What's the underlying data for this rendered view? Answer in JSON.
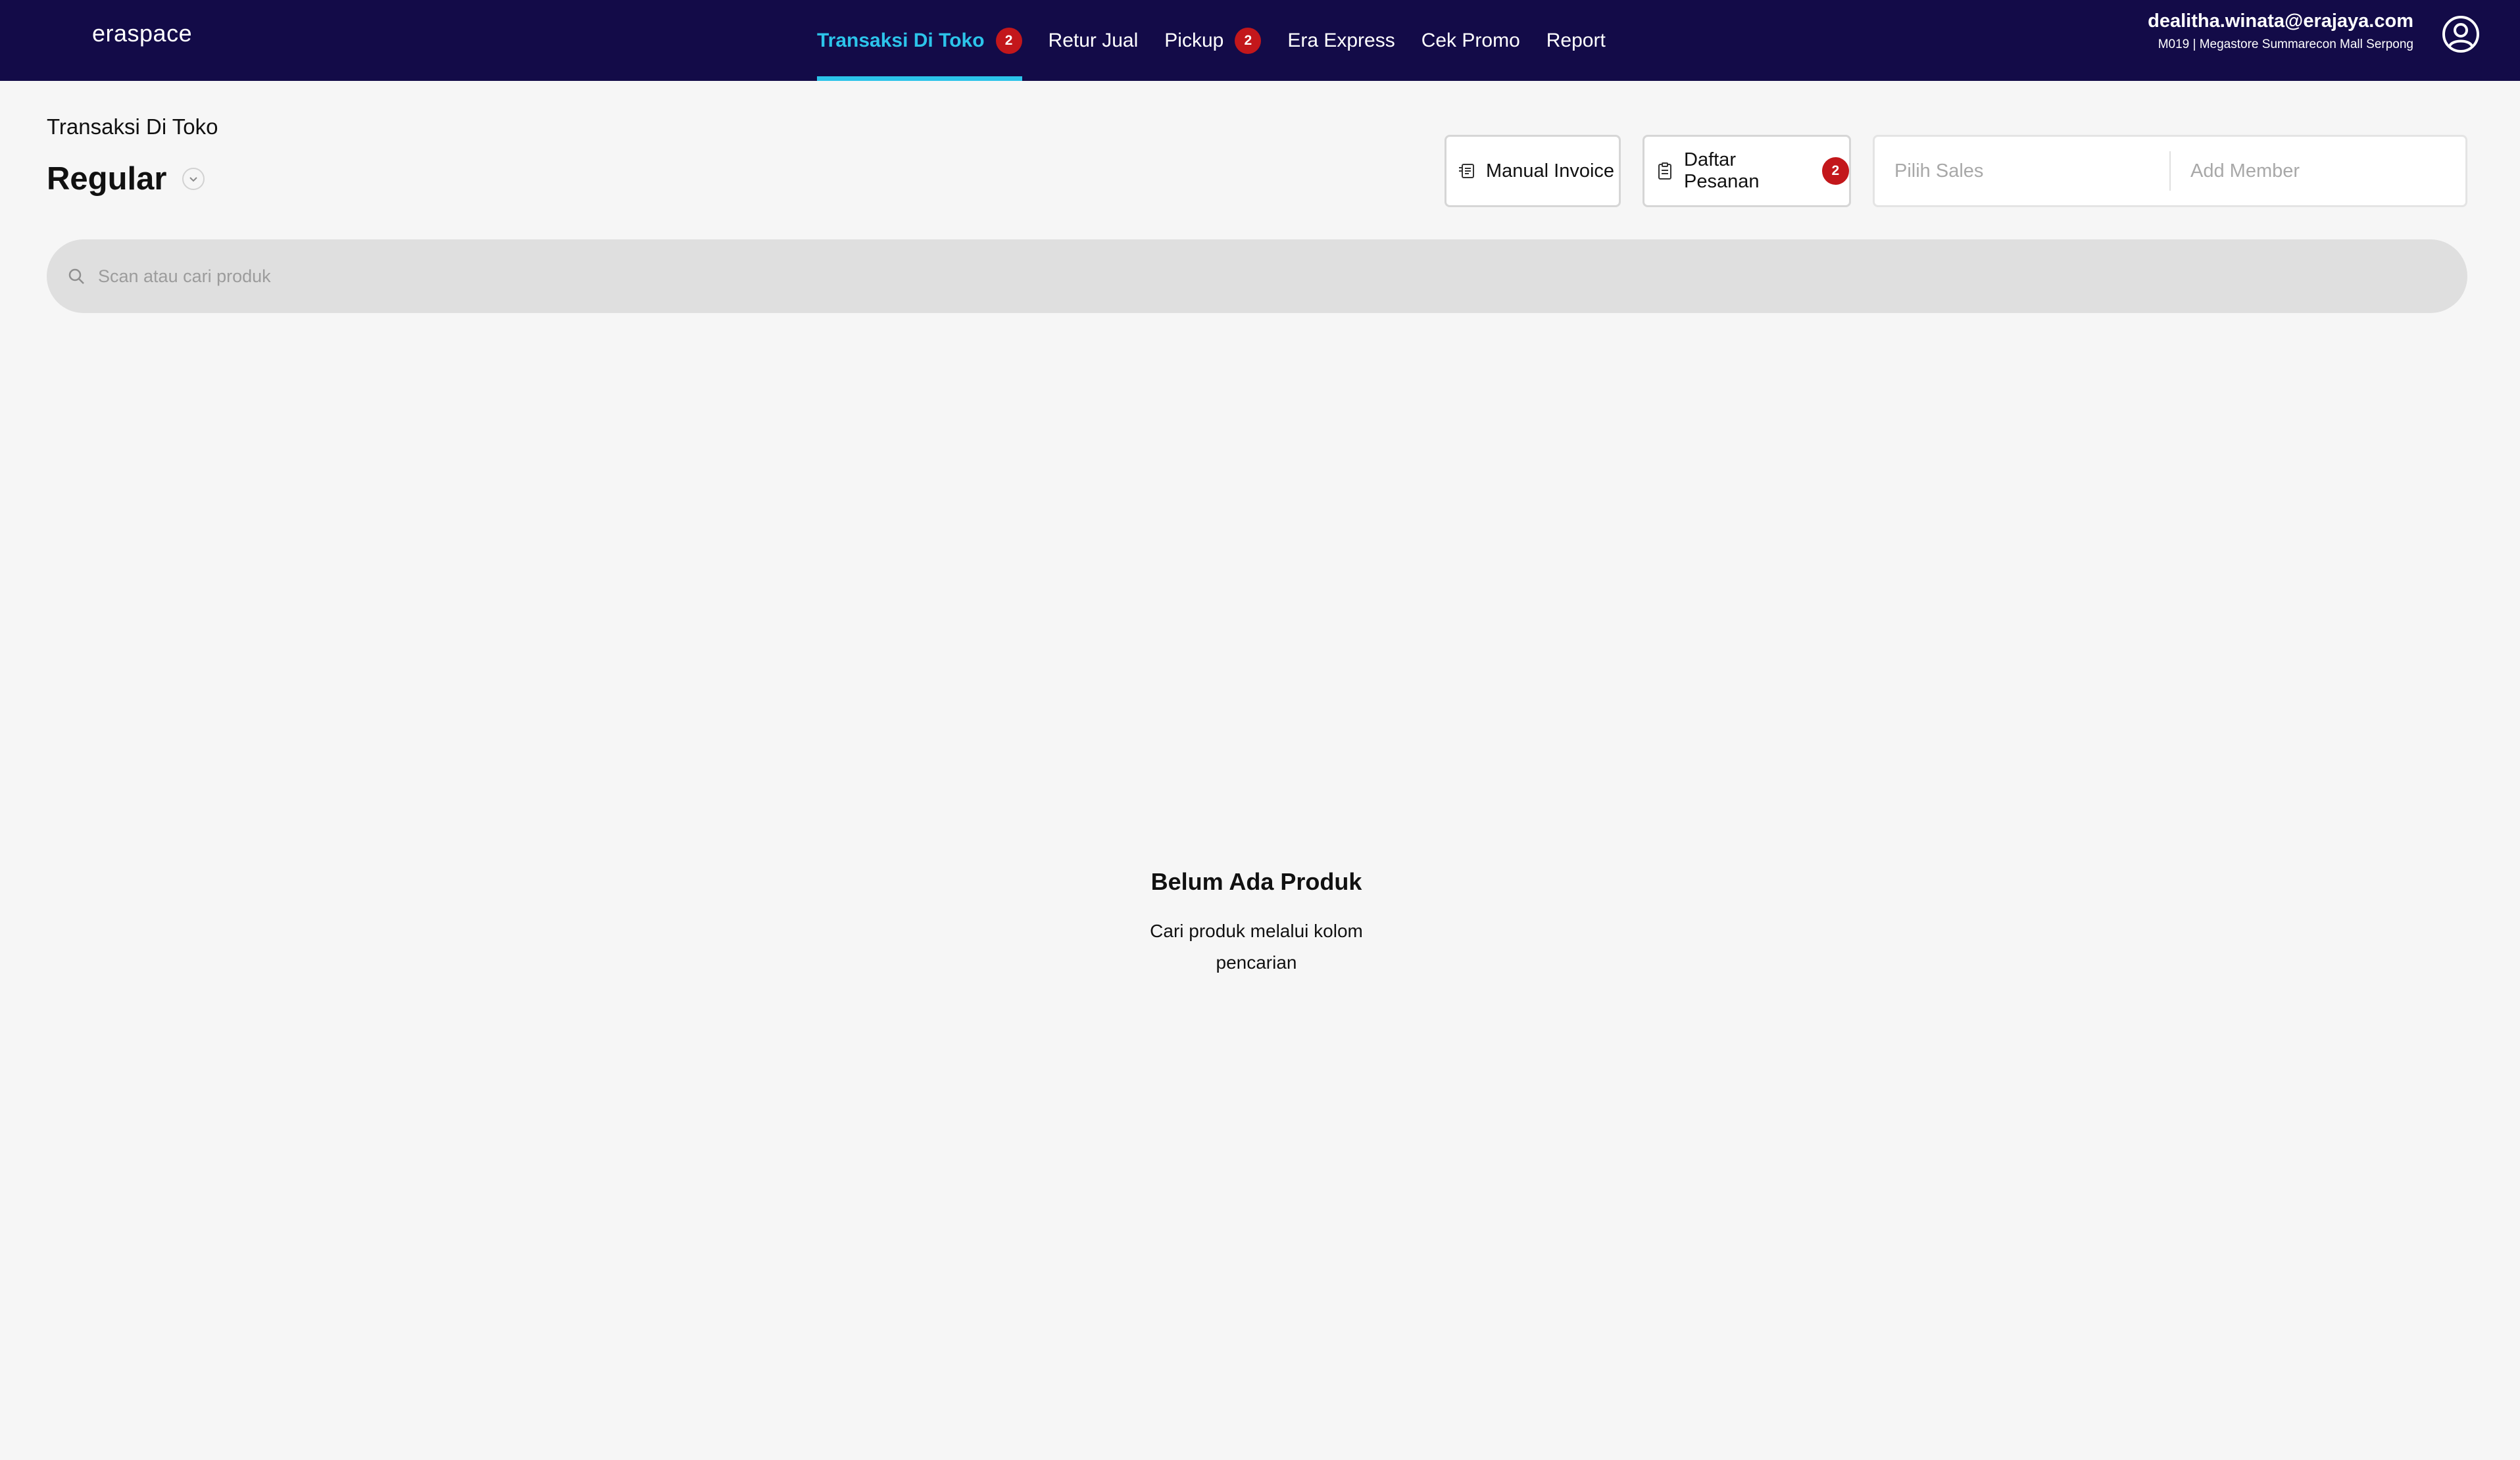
{
  "brand": {
    "logo_text": "eraspace"
  },
  "nav": {
    "items": [
      {
        "label": "Transaksi Di Toko",
        "badge": "2",
        "active": true
      },
      {
        "label": "Retur Jual",
        "badge": "",
        "active": false
      },
      {
        "label": "Pickup",
        "badge": "2",
        "active": false
      },
      {
        "label": "Era Express",
        "badge": "",
        "active": false
      },
      {
        "label": "Cek Promo",
        "badge": "",
        "active": false
      },
      {
        "label": "Report",
        "badge": "",
        "active": false
      }
    ]
  },
  "user": {
    "email": "dealitha.winata@erajaya.com",
    "store": "M019 | Megastore Summarecon Mall Serpong"
  },
  "page": {
    "breadcrumb": "Transaksi Di Toko",
    "title": "Regular"
  },
  "actions": {
    "manual_invoice_label": "Manual Invoice",
    "daftar_pesanan_label": "Daftar Pesanan",
    "daftar_pesanan_badge": "2"
  },
  "fields": {
    "sales_placeholder": "Pilih Sales",
    "member_placeholder": "Add Member"
  },
  "search": {
    "placeholder": "Scan atau cari produk"
  },
  "empty_state": {
    "title": "Belum Ada Produk",
    "description": "Cari produk melalui kolom pencarian"
  },
  "colors": {
    "topbar_bg": "#130b48",
    "accent": "#2cc4ea",
    "badge": "#c3171b",
    "page_bg": "#f6f6f6"
  },
  "icons": {
    "profile": "user-circle-icon",
    "manual_invoice": "invoice-icon",
    "daftar_pesanan": "clipboard-icon",
    "search": "search-icon",
    "title_dropdown": "chevron-down-icon"
  }
}
